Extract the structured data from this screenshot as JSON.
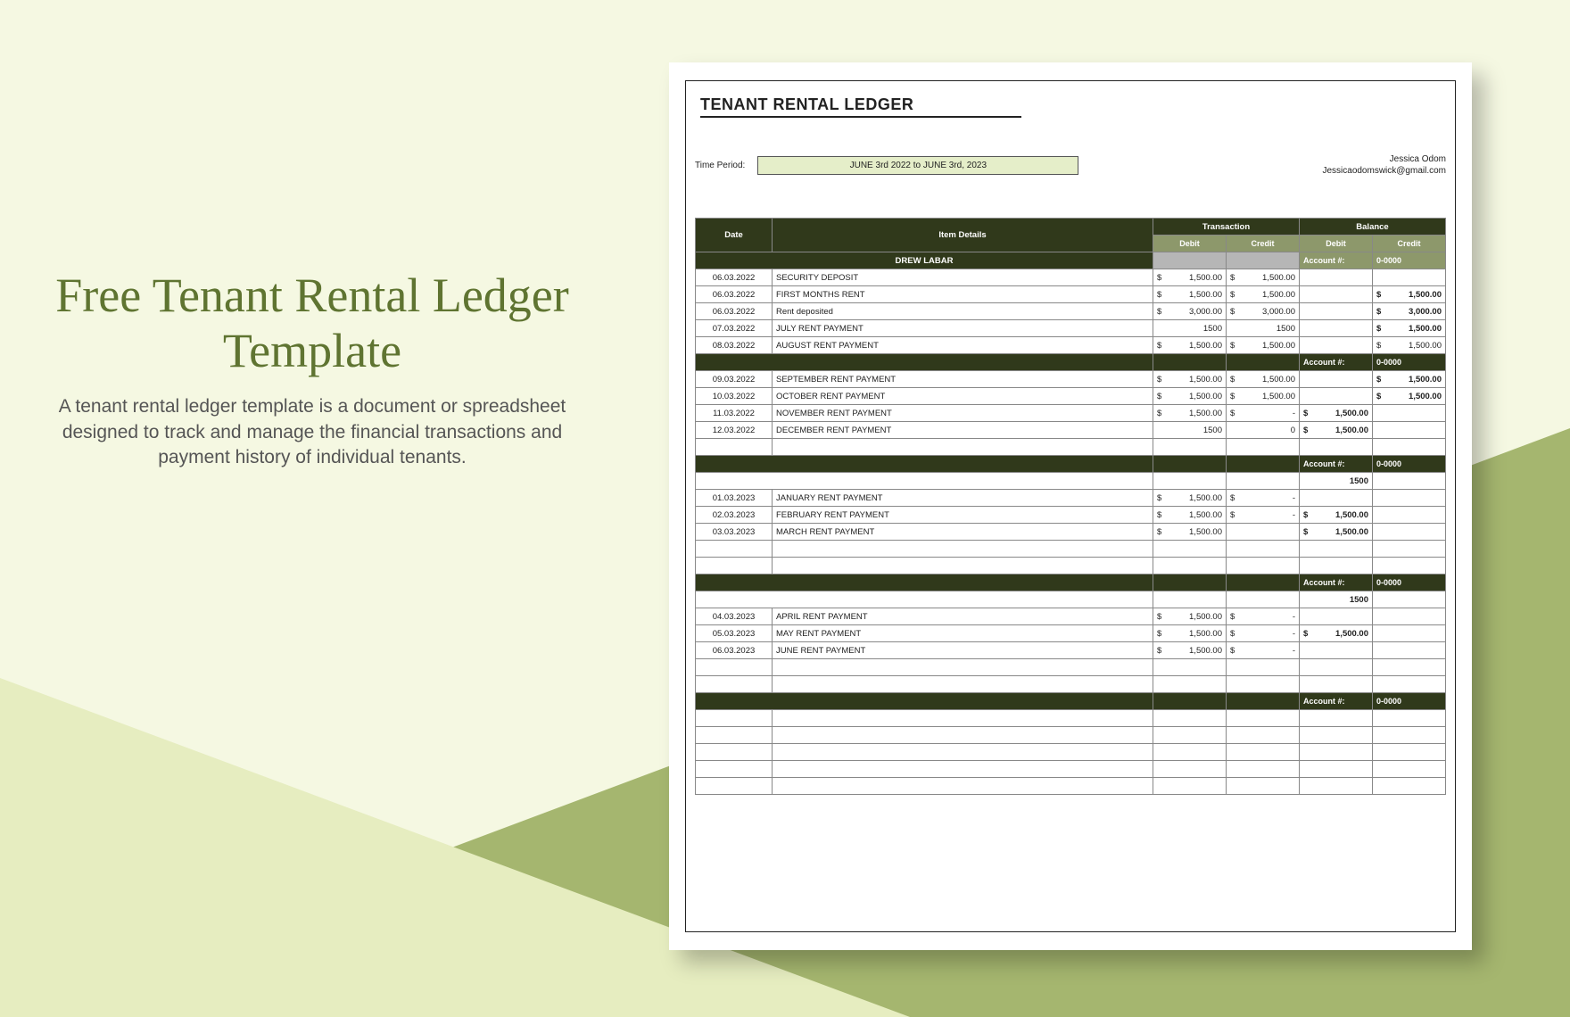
{
  "left": {
    "title": "Free Tenant Rental Ledger Template",
    "desc": "A tenant rental ledger template is a document or spreadsheet designed to track and manage the financial transactions and payment history of individual tenants."
  },
  "ledger": {
    "title": "TENANT RENTAL LEDGER",
    "period_label": "Time Period:",
    "period_value": "JUNE 3rd 2022 to JUNE 3rd, 2023",
    "contact_name": "Jessica Odom",
    "contact_email": "Jessicaodomswick@gmail.com",
    "cols": {
      "date": "Date",
      "item": "Item Details",
      "trans": "Transaction",
      "bal": "Balance",
      "debit": "Debit",
      "credit": "Credit"
    },
    "tenant": "DREW LABAR",
    "acc_label": "Account #:",
    "acc_num": "0-0000",
    "blocks": [
      {
        "rows": [
          {
            "date": "06.03.2022",
            "item": "SECURITY DEPOSIT",
            "td": "1,500.00",
            "tc": "1,500.00",
            "bd": "",
            "bc": "",
            "bold": false,
            "plain": false
          },
          {
            "date": "06.03.2022",
            "item": "FIRST MONTHS RENT",
            "td": "1,500.00",
            "tc": "1,500.00",
            "bd": "",
            "bc": "1,500.00",
            "bold": true,
            "plain": false
          },
          {
            "date": "06.03.2022",
            "item": "Rent deposited",
            "td": "3,000.00",
            "tc": "3,000.00",
            "bd": "",
            "bc": "3,000.00",
            "bold": true,
            "plain": false
          },
          {
            "date": "07.03.2022",
            "item": "JULY RENT PAYMENT",
            "td": "1500",
            "tc": "1500",
            "bd": "",
            "bc": "1,500.00",
            "bold": true,
            "plain": true
          },
          {
            "date": "08.03.2022",
            "item": "AUGUST RENT PAYMENT",
            "td": "1,500.00",
            "tc": "1,500.00",
            "bd": "",
            "bc": "1,500.00",
            "bold": false,
            "plain": false
          }
        ]
      },
      {
        "rows": [
          {
            "date": "09.03.2022",
            "item": "SEPTEMBER RENT PAYMENT",
            "td": "1,500.00",
            "tc": "1,500.00",
            "bd": "",
            "bc": "1,500.00",
            "bold": true,
            "plain": false
          },
          {
            "date": "10.03.2022",
            "item": "OCTOBER RENT PAYMENT",
            "td": "1,500.00",
            "tc": "1,500.00",
            "bd": "",
            "bc": "1,500.00",
            "bold": true,
            "plain": false
          },
          {
            "date": "11.03.2022",
            "item": "NOVEMBER RENT PAYMENT",
            "td": "1,500.00",
            "tc": "-",
            "bd": "1,500.00",
            "bc": "",
            "bold": true,
            "plain": false
          },
          {
            "date": "12.03.2022",
            "item": "DECEMBER RENT PAYMENT",
            "td": "1500",
            "tc": "0",
            "bd": "1,500.00",
            "bc": "",
            "bold": true,
            "plain": true
          },
          {
            "date": "",
            "item": "",
            "td": "",
            "tc": "",
            "bd": "",
            "bc": "",
            "bold": false,
            "plain": true
          }
        ]
      },
      {
        "top_extra": "1500",
        "rows": [
          {
            "date": "01.03.2023",
            "item": "JANUARY RENT PAYMENT",
            "td": "1,500.00",
            "tc": "-",
            "bd": "",
            "bc": "",
            "bold": false,
            "plain": false
          },
          {
            "date": "02.03.2023",
            "item": "FEBRUARY RENT PAYMENT",
            "td": "1,500.00",
            "tc": "-",
            "bd": "1,500.00",
            "bc": "",
            "bold": true,
            "plain": false
          },
          {
            "date": "03.03.2023",
            "item": "MARCH RENT PAYMENT",
            "td": "1,500.00",
            "tc": "",
            "bd": "1,500.00",
            "bc": "",
            "bold": true,
            "plain": false
          },
          {
            "date": "",
            "item": "",
            "td": "",
            "tc": "",
            "bd": "",
            "bc": "",
            "bold": false,
            "plain": true
          },
          {
            "date": "",
            "item": "",
            "td": "",
            "tc": "",
            "bd": "",
            "bc": "",
            "bold": false,
            "plain": true
          }
        ]
      },
      {
        "top_extra": "1500",
        "rows": [
          {
            "date": "04.03.2023",
            "item": "APRIL RENT PAYMENT",
            "td": "1,500.00",
            "tc": "-",
            "bd": "",
            "bc": "",
            "bold": false,
            "plain": false
          },
          {
            "date": "05.03.2023",
            "item": "MAY RENT PAYMENT",
            "td": "1,500.00",
            "tc": "-",
            "bd": "1,500.00",
            "bc": "",
            "bold": true,
            "plain": false
          },
          {
            "date": "06.03.2023",
            "item": "JUNE RENT PAYMENT",
            "td": "1,500.00",
            "tc": "-",
            "bd": "",
            "bc": "",
            "bold": false,
            "plain": false
          },
          {
            "date": "",
            "item": "",
            "td": "",
            "tc": "",
            "bd": "",
            "bc": "",
            "bold": false,
            "plain": true
          },
          {
            "date": "",
            "item": "",
            "td": "",
            "tc": "",
            "bd": "",
            "bc": "",
            "bold": false,
            "plain": true
          }
        ]
      },
      {
        "rows": [
          {
            "date": "",
            "item": "",
            "td": "",
            "tc": "",
            "bd": "",
            "bc": "",
            "bold": false,
            "plain": true
          },
          {
            "date": "",
            "item": "",
            "td": "",
            "tc": "",
            "bd": "",
            "bc": "",
            "bold": false,
            "plain": true
          },
          {
            "date": "",
            "item": "",
            "td": "",
            "tc": "",
            "bd": "",
            "bc": "",
            "bold": false,
            "plain": true
          },
          {
            "date": "",
            "item": "",
            "td": "",
            "tc": "",
            "bd": "",
            "bc": "",
            "bold": false,
            "plain": true
          },
          {
            "date": "",
            "item": "",
            "td": "",
            "tc": "",
            "bd": "",
            "bc": "",
            "bold": false,
            "plain": true
          }
        ]
      }
    ]
  }
}
